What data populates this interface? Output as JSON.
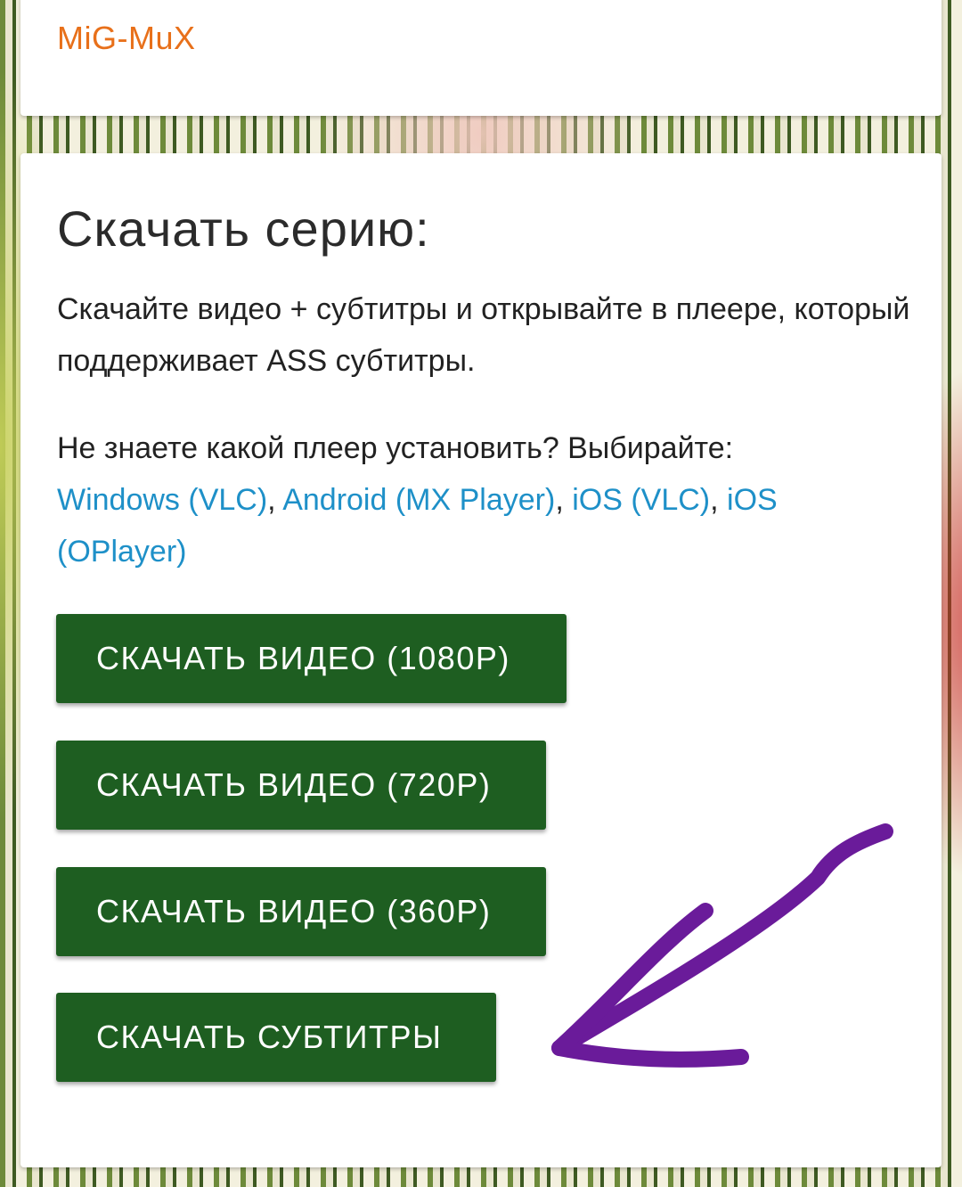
{
  "header": {
    "brand": "MiG-MuX"
  },
  "download": {
    "title": "Скачать серию:",
    "description": "Скачайте видео + субтитры и открывайте в плеере, который поддерживает ASS субтитры.",
    "player_prompt": "Не знаете какой плеер установить? Выбирайте:",
    "links": [
      "Windows (VLC)",
      "Android (MX Player)",
      "iOS (VLC)",
      "iOS (OPlayer)"
    ],
    "separator": ", ",
    "buttons": [
      "СКАЧАТЬ ВИДЕО (1080P)",
      "СКАЧАТЬ ВИДЕО (720P)",
      "СКАЧАТЬ ВИДЕО (360P)",
      "СКАЧАТЬ СУБТИТРЫ"
    ]
  },
  "colors": {
    "brand": "#e8701a",
    "link": "#1e90c8",
    "button": "#1e5e21",
    "annotation_arrow": "#6a1b9a"
  },
  "icons": {
    "annotation": "hand-drawn-arrow-icon"
  }
}
